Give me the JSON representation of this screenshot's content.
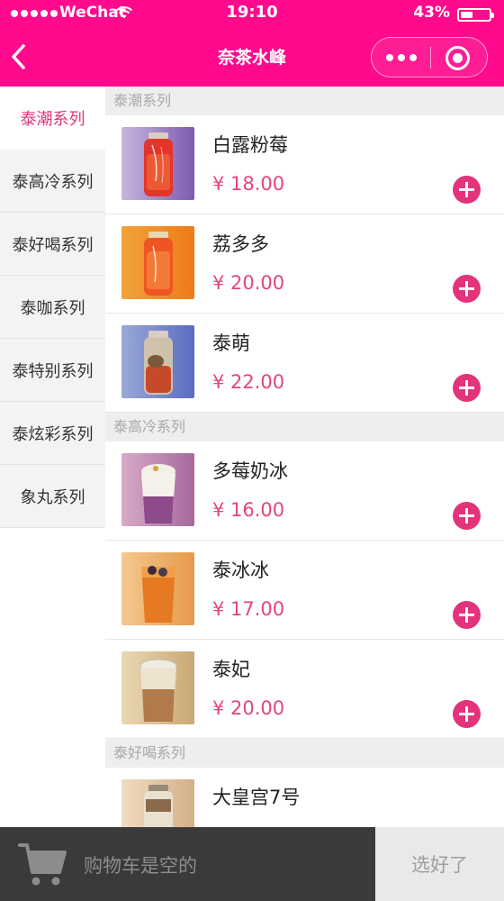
{
  "status_bar": {
    "carrier": "WeChat",
    "time": "19:10",
    "battery": "43%",
    "battery_level": 0.43
  },
  "nav": {
    "title": "奈茶水峰",
    "back_icon": "chevron-left-icon",
    "more_icon": "more-dots-icon",
    "close_icon": "target-icon"
  },
  "categories": [
    {
      "label": "泰潮系列",
      "active": true
    },
    {
      "label": "泰高冷系列",
      "active": false
    },
    {
      "label": "泰好喝系列",
      "active": false
    },
    {
      "label": "泰咖系列",
      "active": false
    },
    {
      "label": "泰特别系列",
      "active": false
    },
    {
      "label": "泰炫彩系列",
      "active": false
    },
    {
      "label": "象丸系列",
      "active": false
    }
  ],
  "sections": [
    {
      "title": "泰潮系列",
      "items": [
        {
          "name": "白露粉莓",
          "price": "¥ 18.00"
        },
        {
          "name": "荔多多",
          "price": "¥ 20.00"
        },
        {
          "name": "泰萌",
          "price": "¥ 22.00"
        }
      ]
    },
    {
      "title": "泰高冷系列",
      "items": [
        {
          "name": "多莓奶冰",
          "price": "¥ 16.00"
        },
        {
          "name": "泰冰冰",
          "price": "¥ 17.00"
        },
        {
          "name": "泰妃",
          "price": "¥ 20.00"
        }
      ]
    },
    {
      "title": "泰好喝系列",
      "items": [
        {
          "name": "大皇宫7号",
          "price": ""
        }
      ]
    }
  ],
  "cart": {
    "empty_text": "购物车是空的",
    "checkout_label": "选好了",
    "icon": "cart-icon"
  },
  "colors": {
    "brand": "#ff0a8c",
    "accent": "#e2337b",
    "price": "#e4457d"
  }
}
